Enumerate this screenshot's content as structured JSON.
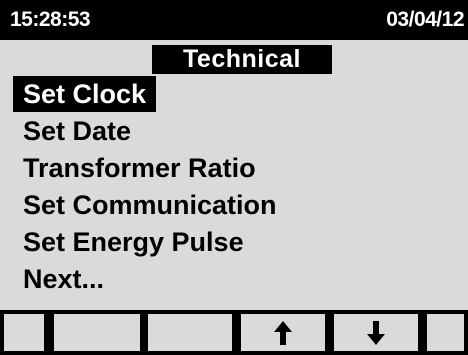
{
  "status_bar": {
    "time": "15:28:53",
    "date": "03/04/12"
  },
  "menu": {
    "title": "Technical",
    "items": [
      {
        "label": "Set Clock",
        "selected": true
      },
      {
        "label": "Set Date",
        "selected": false
      },
      {
        "label": "Transformer Ratio",
        "selected": false
      },
      {
        "label": "Set Communication",
        "selected": false
      },
      {
        "label": "Set Energy Pulse",
        "selected": false
      },
      {
        "label": "Next...",
        "selected": false
      }
    ]
  },
  "softkeys": [
    {
      "icon": ""
    },
    {
      "icon": ""
    },
    {
      "icon": ""
    },
    {
      "icon": "arrow-up-icon"
    },
    {
      "icon": "arrow-down-icon"
    },
    {
      "icon": ""
    }
  ],
  "colors": {
    "background": "#dadada",
    "foreground": "#000000",
    "highlight_text": "#ffffff"
  }
}
